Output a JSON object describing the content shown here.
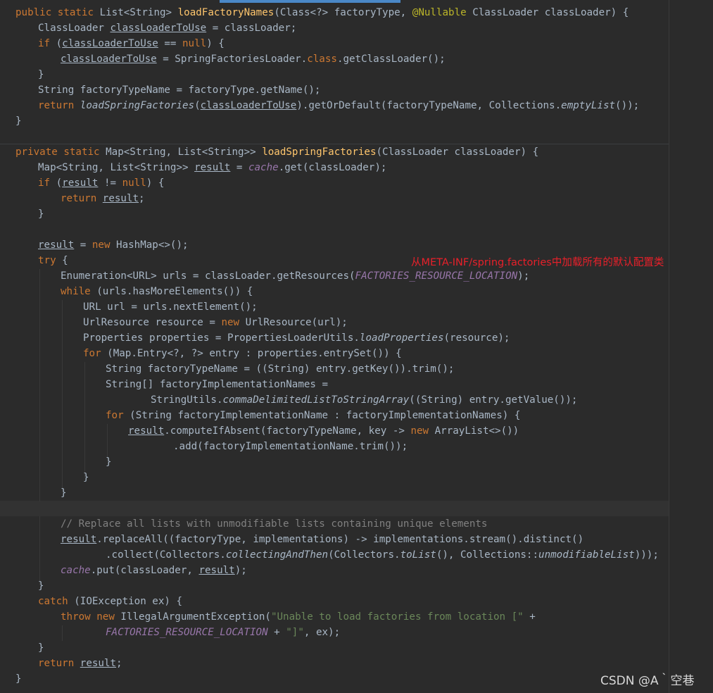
{
  "annotation": "从META-INF/spring.factories中加载所有的默认配置类",
  "watermark": "CSDN @A｀空巷",
  "code": {
    "l1": {
      "t1": "public static ",
      "t2": "List<String> ",
      "t3": "loadFactoryNames",
      "t4": "(Class<?> factoryType, ",
      "t5": "@Nullable ",
      "t6": "ClassLoader classLoader) {"
    },
    "l2": {
      "t1": "ClassLoader ",
      "t2": "classLoaderToUse",
      "t3": " = classLoader;"
    },
    "l3": {
      "t1": "if ",
      "t2": "(",
      "t3": "classLoaderToUse",
      "t4": " == ",
      "t5": "null",
      "t6": ") {"
    },
    "l4": {
      "t1": "classLoaderToUse",
      "t2": " = SpringFactoriesLoader.",
      "t3": "class",
      "t4": ".getClassLoader();"
    },
    "l5": {
      "t1": "}"
    },
    "l6": {
      "t1": "String factoryTypeName = factoryType.getName();"
    },
    "l7": {
      "t1": "return ",
      "t2": "loadSpringFactories",
      "t3": "(",
      "t4": "classLoaderToUse",
      "t5": ").getOrDefault(factoryTypeName, Collections.",
      "t6": "emptyList",
      "t7": "());"
    },
    "l8": {
      "t1": "}"
    },
    "l9": {
      "t1": "private static ",
      "t2": "Map<String, List<String>> ",
      "t3": "loadSpringFactories",
      "t4": "(ClassLoader classLoader) {"
    },
    "l10": {
      "t1": "Map<String, List<String>> ",
      "t2": "result",
      "t3": " = ",
      "t4": "cache",
      "t5": ".get(classLoader);"
    },
    "l11": {
      "t1": "if ",
      "t2": "(",
      "t3": "result",
      "t4": " != ",
      "t5": "null",
      "t6": ") {"
    },
    "l12": {
      "t1": "return ",
      "t2": "result",
      "t3": ";"
    },
    "l13": {
      "t1": "}"
    },
    "l14": {
      "t1": "result",
      "t2": " = ",
      "t3": "new ",
      "t4": "HashMap<>();"
    },
    "l15": {
      "t1": "try ",
      "t2": "{"
    },
    "l16": {
      "t1": "Enumeration<URL> urls = classLoader.getResources(",
      "t2": "FACTORIES_RESOURCE_LOCATION",
      "t3": ");"
    },
    "l17": {
      "t1": "while ",
      "t2": "(urls.hasMoreElements()) {"
    },
    "l18": {
      "t1": "URL url = urls.nextElement();"
    },
    "l19": {
      "t1": "UrlResource resource = ",
      "t2": "new ",
      "t3": "UrlResource(url);"
    },
    "l20": {
      "t1": "Properties properties = PropertiesLoaderUtils.",
      "t2": "loadProperties",
      "t3": "(resource);"
    },
    "l21": {
      "t1": "for ",
      "t2": "(Map.Entry<?, ?> entry : properties.entrySet()) {"
    },
    "l22": {
      "t1": "String factoryTypeName = ((String) entry.getKey()).trim();"
    },
    "l23": {
      "t1": "String[] factoryImplementationNames ="
    },
    "l24": {
      "t1": "StringUtils.",
      "t2": "commaDelimitedListToStringArray",
      "t3": "((String) entry.getValue());"
    },
    "l25": {
      "t1": "for ",
      "t2": "(String factoryImplementationName : factoryImplementationNames) {"
    },
    "l26": {
      "t1": "result",
      "t2": ".computeIfAbsent(factoryTypeName, key -> ",
      "t3": "new ",
      "t4": "ArrayList<>())"
    },
    "l27": {
      "t1": ".add(factoryImplementationName.trim());"
    },
    "l28": {
      "t1": "}"
    },
    "l29": {
      "t1": "}"
    },
    "l30": {
      "t1": "}"
    },
    "l31": {
      "t1": "// Replace all lists with unmodifiable lists containing unique elements"
    },
    "l32": {
      "t1": "result",
      "t2": ".replaceAll((factoryType, implementations) -> implementations.stream().distinct()"
    },
    "l33": {
      "t1": ".collect(Collectors.",
      "t2": "collectingAndThen",
      "t3": "(Collectors.",
      "t4": "toList",
      "t5": "(), Collections::",
      "t6": "unmodifiableList",
      "t7": ")));"
    },
    "l34": {
      "t1": "cache",
      "t2": ".put(classLoader, ",
      "t3": "result",
      "t4": ");"
    },
    "l35": {
      "t1": "}"
    },
    "l36": {
      "t1": "catch ",
      "t2": "(IOException ex) {"
    },
    "l37": {
      "t1": "throw new ",
      "t2": "IllegalArgumentException(",
      "t3": "\"Unable to load factories from location [\" ",
      "t4": "+"
    },
    "l38": {
      "t1": "FACTORIES_RESOURCE_LOCATION",
      "t2": " + ",
      "t3": "\"]\"",
      "t4": ", ex);"
    },
    "l39": {
      "t1": "return ",
      "t2": "result",
      "t3": ";"
    },
    "l40": {
      "t1": "}"
    }
  }
}
